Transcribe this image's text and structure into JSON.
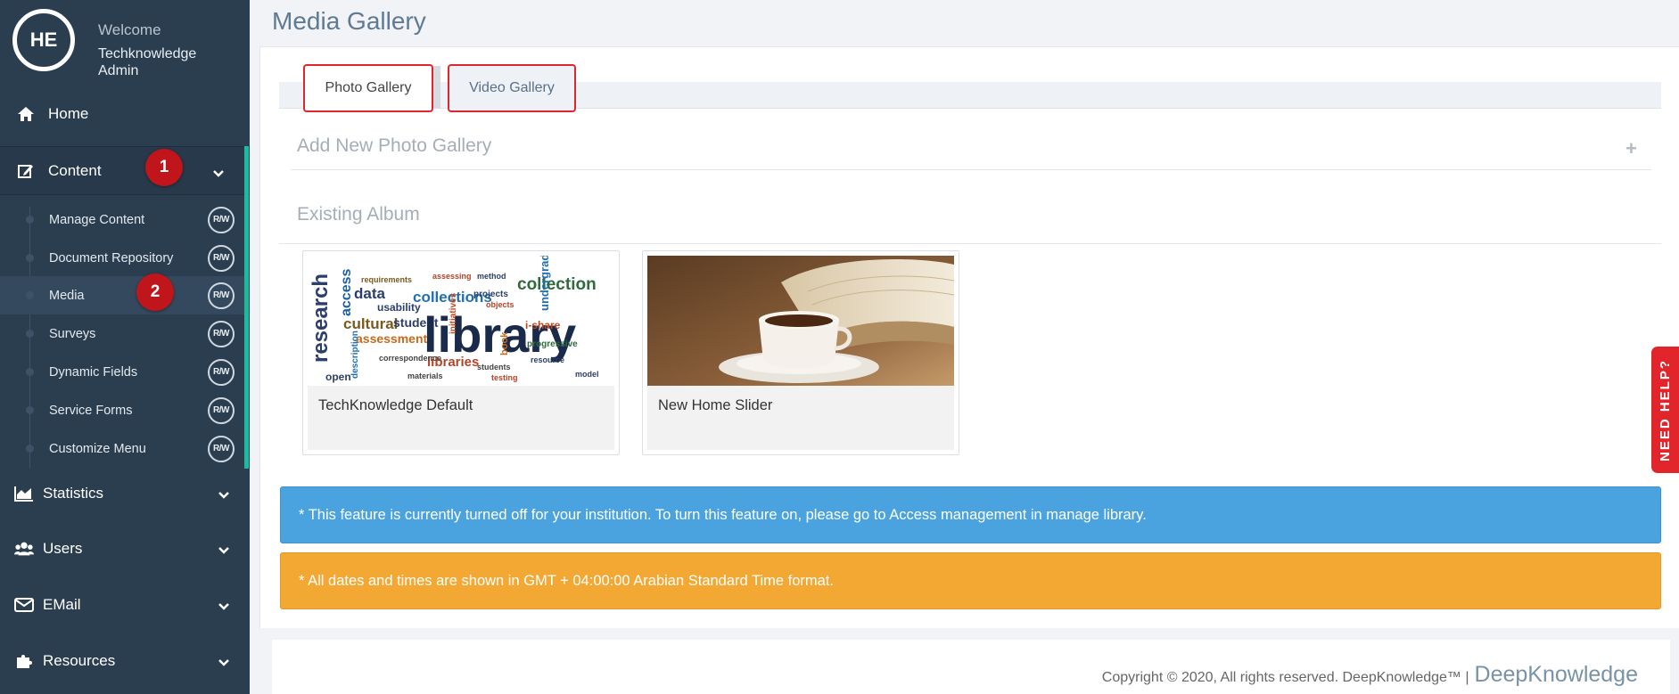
{
  "profile": {
    "initials": "HE",
    "welcome": "Welcome",
    "username": "Techknowledge Admin"
  },
  "nav": {
    "home": "Home",
    "content": "Content",
    "statistics": "Statistics",
    "users": "Users",
    "email": "EMail",
    "resources": "Resources"
  },
  "submenu": [
    {
      "label": "Manage Content",
      "access": "R/W"
    },
    {
      "label": "Document Repository",
      "access": "R/W"
    },
    {
      "label": "Media",
      "access": "R/W"
    },
    {
      "label": "Surveys",
      "access": "R/W"
    },
    {
      "label": "Dynamic Fields",
      "access": "R/W"
    },
    {
      "label": "Service Forms",
      "access": "R/W"
    },
    {
      "label": "Customize Menu",
      "access": "R/W"
    }
  ],
  "steps": {
    "one": "1",
    "two": "2"
  },
  "page": {
    "title": "Media Gallery",
    "tabs": {
      "photo": "Photo Gallery",
      "video": "Video Gallery"
    },
    "add_new": "Add New Photo Gallery",
    "existing": "Existing Album"
  },
  "albums": [
    {
      "name": "TechKnowledge Default"
    },
    {
      "name": "New Home Slider"
    }
  ],
  "alerts": {
    "info": "* This feature is currently turned off for your institution. To turn this feature on, please go to Access management in manage library.",
    "warning": "* All dates and times are shown in GMT + 04:00:00 Arabian Standard Time format."
  },
  "footer": {
    "copyright": "Copyright © 2020, All rights reserved. DeepKnowledge™ |",
    "brand": "DeepKnowledge"
  },
  "help": {
    "label": "NEED HELP?"
  },
  "colors": {
    "sidebar": "#2b3e50",
    "accent_green": "#1abc9c",
    "badge_red": "#c0151b",
    "info_blue": "#4aa3df",
    "warning_orange": "#f2a833"
  }
}
